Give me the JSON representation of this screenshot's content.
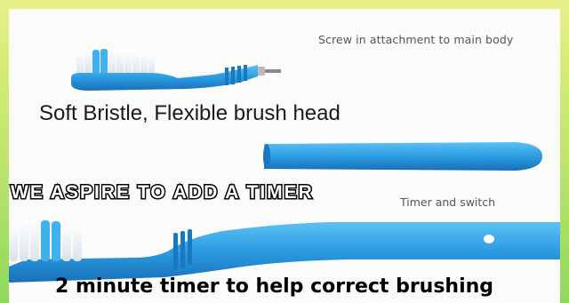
{
  "captions": {
    "attachment": "Screw in attachment to main body",
    "soft_bristle": "Soft Bristle, Flexible brush head",
    "timer_switch": "Timer and switch"
  },
  "overlay": {
    "banner": "We aspire to add a timer",
    "bottom": "2 minute timer to help correct brushing"
  },
  "colors": {
    "brush_blue": "#2a9be0",
    "brush_blue_dark": "#1a78c2",
    "bristle": "#f3f6f8",
    "bristle_accent": "#3fb0f0",
    "background_green": "#a8dd66"
  }
}
